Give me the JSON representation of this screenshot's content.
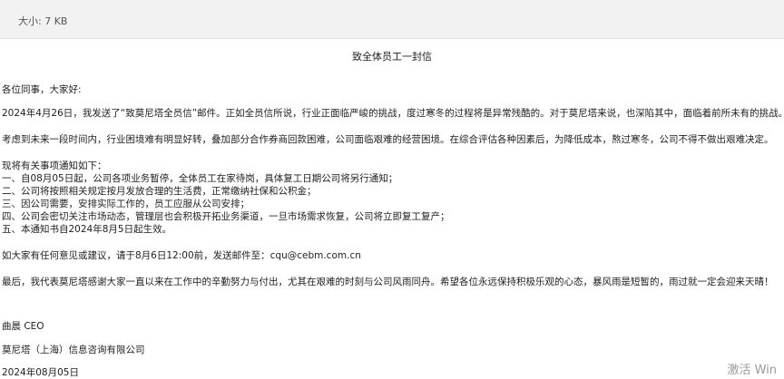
{
  "header": {
    "file_size": "大小: 7 KB"
  },
  "letter": {
    "title": "致全体员工一封信",
    "greeting": "各位同事，大家好:",
    "para1": "2024年4月26日，我发送了“致莫尼塔全员信”邮件。正如全员信所说，行业正面临严峻的挑战，度过寒冬的过程将是异常残酷的。对于莫尼塔来说，也深陷其中，面临着前所未有的挑战。",
    "para2": "考虑到未来一段时间内，行业困境难有明显好转，叠加部分合作券商回款困难，公司面临艰难的经营困境。在综合评估各种因素后，为降低成本，熬过寒冬，公司不得不做出艰难决定。",
    "notice_intro": "现将有关事项通知如下：",
    "items": [
      "一、自08月05日起，公司各项业务暂停，全体员工在家待岗，具体复工日期公司将另行通知；",
      "二、公司将按照相关规定按月发放合理的生活费，正常缴纳社保和公积金；",
      "三、因公司需要，安排实际工作的，员工应服从公司安排；",
      "四、公司会密切关注市场动态，管理层也会积极开拓业务渠道，一旦市场需求恢复，公司将立即复工复产；",
      "五、本通知书自2024年8月5日起生效。"
    ],
    "feedback_prefix": "如大家有任何意见或建议，请于8月6日12:00前，发送邮件至：",
    "feedback_email": "cqu@cebm.com.cn",
    "closing": "最后，我代表莫尼塔感谢大家一直以来在工作中的辛勤努力与付出，尤其在艰难的时刻与公司风雨同舟。希望各位永远保持积极乐观的心态，暴风雨是短暂的，雨过就一定会迎来天晴！",
    "signature_name": "曲晨 CEO",
    "company": "莫尼塔（上海）信息咨询有限公司",
    "date": "2024年08月05日"
  },
  "watermark": {
    "text": "激活 Win"
  }
}
